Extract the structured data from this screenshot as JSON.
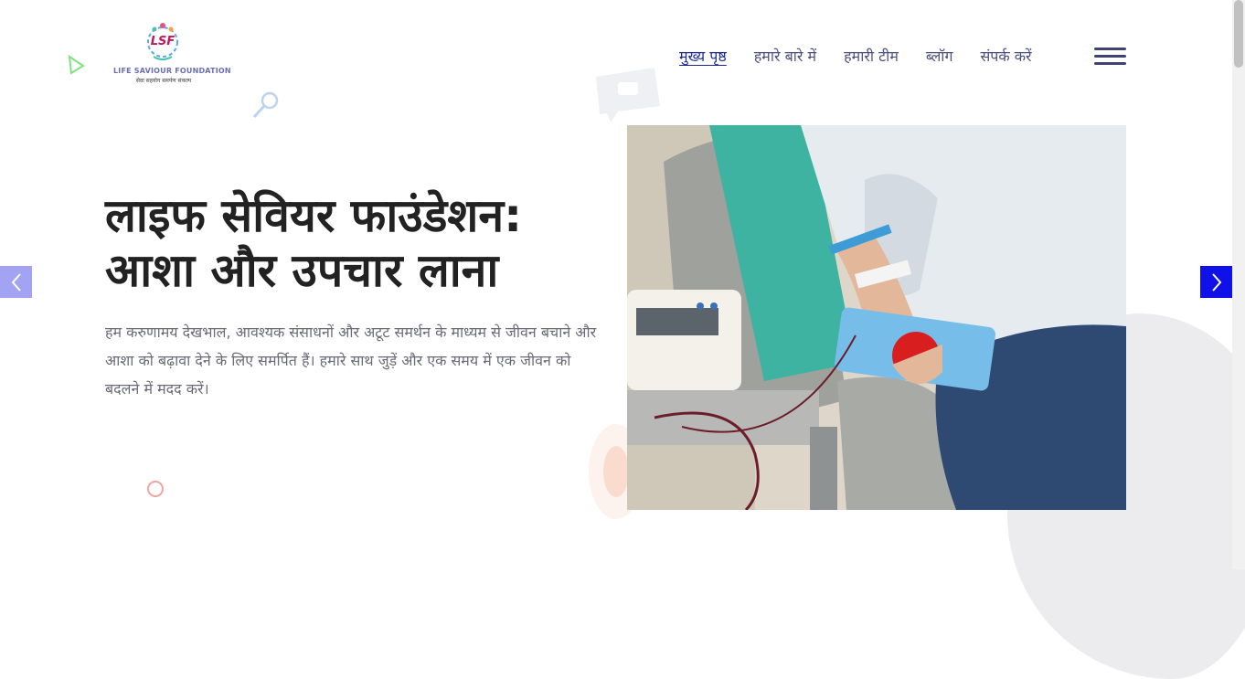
{
  "logo": {
    "mark_text": "LSF",
    "name": "LIFE SAVIOUR FOUNDATION",
    "tagline": "सेवा सहयोग समर्पण संकल्प"
  },
  "nav": {
    "items": [
      {
        "label": "मुख्य पृष्ठ",
        "active": true
      },
      {
        "label": "हमारे बारे में"
      },
      {
        "label": "हमारी टीम"
      },
      {
        "label": "ब्लॉग"
      },
      {
        "label": "संपर्क करें"
      }
    ],
    "menu_icon": "hamburger-icon"
  },
  "hero": {
    "title_line1": "लाइफ सेवियर फाउंडेशन:",
    "title_line2": "आशा और उपचार लाना",
    "description": "हम करुणामय देखभाल, आवश्यक संसाधनों और अटूट समर्थन के माध्यम से जीवन बचाने और आशा को बढ़ावा देने के लिए समर्पित हैं। हमारे साथ जुड़ें और एक समय में एक जीवन को बदलने में मदद करें।"
  },
  "slider": {
    "prev_icon": "chevron-left-icon",
    "next_icon": "chevron-right-icon"
  },
  "colors": {
    "accent": "#1010e8",
    "nav_text": "#4b4f7e",
    "nav_active": "#1b2b94",
    "prev_arrow": "#a3a3f4"
  }
}
